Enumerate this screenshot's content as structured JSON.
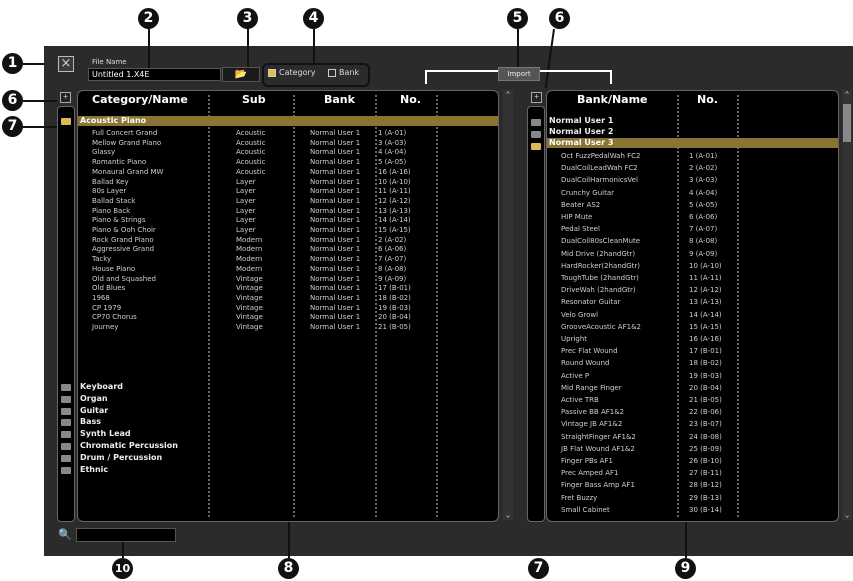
{
  "toolbar": {
    "close_glyph": "×",
    "file_name_label": "File Name",
    "file_name_value": "Untitled 1.X4E",
    "folder_glyph": "📂",
    "category_label": "Category",
    "bank_label": "Bank",
    "import_label": "Import"
  },
  "callouts": [
    "1",
    "2",
    "3",
    "4",
    "5",
    "6",
    "7",
    "8",
    "9",
    "10"
  ],
  "left": {
    "headers": [
      "Category/Name",
      "Sub",
      "Bank",
      "No."
    ],
    "expand_glyph": "+",
    "selected_category": "Acoustic Piano",
    "rows": [
      [
        "Full Concert Grand",
        "Acoustic",
        "Normal User 1",
        "1 (A-01)"
      ],
      [
        "Mellow Grand Piano",
        "Acoustic",
        "Normal User 1",
        "3 (A-03)"
      ],
      [
        "Glassy",
        "Acoustic",
        "Normal User 1",
        "4 (A-04)"
      ],
      [
        "Romantic Piano",
        "Acoustic",
        "Normal User 1",
        "5 (A-05)"
      ],
      [
        "Monaural Grand MW",
        "Acoustic",
        "Normal User 1",
        "16 (A-16)"
      ],
      [
        "Ballad Key",
        "Layer",
        "Normal User 1",
        "10 (A-10)"
      ],
      [
        "80s Layer",
        "Layer",
        "Normal User 1",
        "11 (A-11)"
      ],
      [
        "Ballad Stack",
        "Layer",
        "Normal User 1",
        "12 (A-12)"
      ],
      [
        "Piano Back",
        "Layer",
        "Normal User 1",
        "13 (A-13)"
      ],
      [
        "Piano & Strings",
        "Layer",
        "Normal User 1",
        "14 (A-14)"
      ],
      [
        "Piano & Ooh Choir",
        "Layer",
        "Normal User 1",
        "15 (A-15)"
      ],
      [
        "Rock Grand Piano",
        "Modern",
        "Normal User 1",
        "2 (A-02)"
      ],
      [
        "Aggressive Grand",
        "Modern",
        "Normal User 1",
        "6 (A-06)"
      ],
      [
        "Tacky",
        "Modern",
        "Normal User 1",
        "7 (A-07)"
      ],
      [
        "House Piano",
        "Modern",
        "Normal User 1",
        "8 (A-08)"
      ],
      [
        "Old and Squashed",
        "Vintage",
        "Normal User 1",
        "9 (A-09)"
      ],
      [
        "Old Blues",
        "Vintage",
        "Normal User 1",
        "17 (B-01)"
      ],
      [
        "1968",
        "Vintage",
        "Normal User 1",
        "18 (B-02)"
      ],
      [
        "CP 1979",
        "Vintage",
        "Normal User 1",
        "19 (B-03)"
      ],
      [
        "CP70 Chorus",
        "Vintage",
        "Normal User 1",
        "20 (B-04)"
      ],
      [
        "Journey",
        "Vintage",
        "Normal User 1",
        "21 (B-05)"
      ]
    ],
    "categories": [
      "Keyboard",
      "Organ",
      "Guitar",
      "Bass",
      "Synth Lead",
      "Chromatic Percussion",
      "Drum / Percussion",
      "Ethnic"
    ]
  },
  "right": {
    "headers": [
      "Bank/Name",
      "No."
    ],
    "expand_glyph": "+",
    "banks": [
      "Normal User 1",
      "Normal User 2"
    ],
    "selected_bank": "Normal User 3",
    "rows": [
      [
        "Oct FuzzPedalWah FC2",
        "1 (A-01)"
      ],
      [
        "DualCoilLeadWah FC2",
        "2 (A-02)"
      ],
      [
        "DualCoilHarmonicsVel",
        "3 (A-03)"
      ],
      [
        "Crunchy Guitar",
        "4 (A-04)"
      ],
      [
        "Beater AS2",
        "5 (A-05)"
      ],
      [
        "HIP Mute",
        "6 (A-06)"
      ],
      [
        "Pedal Steel",
        "7 (A-07)"
      ],
      [
        "DualCoil80sCleanMute",
        "8 (A-08)"
      ],
      [
        "Mid Drive (2handGtr)",
        "9 (A-09)"
      ],
      [
        "HardRocker(2handGtr)",
        "10 (A-10)"
      ],
      [
        "ToughTube (2handGtr)",
        "11 (A-11)"
      ],
      [
        "DriveWah (2handGtr)",
        "12 (A-12)"
      ],
      [
        "Resonator Guitar",
        "13 (A-13)"
      ],
      [
        "Velo Growl",
        "14 (A-14)"
      ],
      [
        "GrooveAcoustic AF1&2",
        "15 (A-15)"
      ],
      [
        "Upright",
        "16 (A-16)"
      ],
      [
        "Prec Flat Wound",
        "17 (B-01)"
      ],
      [
        "Round Wound",
        "18 (B-02)"
      ],
      [
        "Active P",
        "19 (B-03)"
      ],
      [
        "Mid Range Finger",
        "20 (B-04)"
      ],
      [
        "Active TRB",
        "21 (B-05)"
      ],
      [
        "Passive BB AF1&2",
        "22 (B-06)"
      ],
      [
        "Vintage JB AF1&2",
        "23 (B-07)"
      ],
      [
        "StraightFinger AF1&2",
        "24 (B-08)"
      ],
      [
        "JB Flat Wound AF1&2",
        "25 (B-09)"
      ],
      [
        "Finger PBs AF1",
        "26 (B-10)"
      ],
      [
        "Prec Amped AF1",
        "27 (B-11)"
      ],
      [
        "Finger Bass Amp AF1",
        "28 (B-12)"
      ],
      [
        "Fret Buzzy",
        "29 (B-13)"
      ],
      [
        "Small Cabinet",
        "30 (B-14)"
      ]
    ]
  },
  "search": {
    "icon_glyph": "🔍",
    "value": ""
  },
  "scroll": {
    "up_glyph": "⌃",
    "down_glyph": "⌄"
  }
}
